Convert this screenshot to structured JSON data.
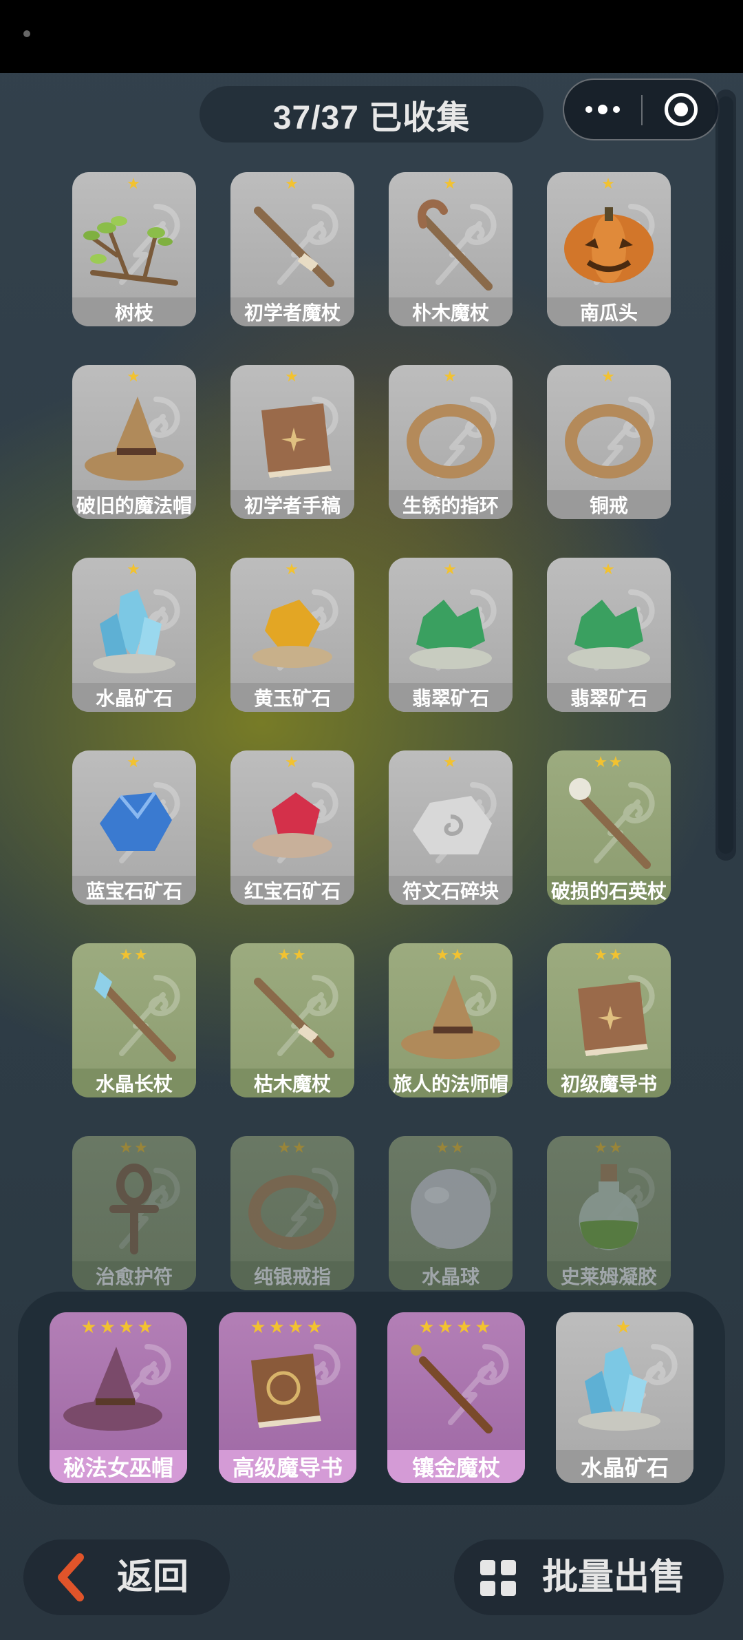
{
  "header": {
    "title": "37/37 已收集"
  },
  "collection": [
    {
      "label": "树枝",
      "stars": "★",
      "style": "g",
      "icon": "branch-icon"
    },
    {
      "label": "初学者魔杖",
      "stars": "★",
      "style": "g",
      "icon": "wand-icon"
    },
    {
      "label": "朴木魔杖",
      "stars": "★",
      "style": "g",
      "icon": "staff-icon"
    },
    {
      "label": "南瓜头",
      "stars": "★",
      "style": "g",
      "icon": "pumpkin-icon"
    },
    {
      "label": "破旧的魔法帽",
      "stars": "★",
      "style": "g",
      "icon": "hat-icon"
    },
    {
      "label": "初学者手稿",
      "stars": "★",
      "style": "g",
      "icon": "book-icon"
    },
    {
      "label": "生锈的指环",
      "stars": "★",
      "style": "g",
      "icon": "ring-icon"
    },
    {
      "label": "铜戒",
      "stars": "★",
      "style": "g",
      "icon": "ring-icon"
    },
    {
      "label": "水晶矿石",
      "stars": "★",
      "style": "g",
      "icon": "crystal-icon"
    },
    {
      "label": "黄玉矿石",
      "stars": "★",
      "style": "g",
      "icon": "topaz-icon"
    },
    {
      "label": "翡翠矿石",
      "stars": "★",
      "style": "g",
      "icon": "emerald-icon"
    },
    {
      "label": "翡翠矿石",
      "stars": "★",
      "style": "g",
      "icon": "emerald-icon"
    },
    {
      "label": "蓝宝石矿石",
      "stars": "★",
      "style": "g",
      "icon": "sapphire-icon"
    },
    {
      "label": "红宝石矿石",
      "stars": "★",
      "style": "g",
      "icon": "ruby-icon"
    },
    {
      "label": "符文石碎块",
      "stars": "★",
      "style": "g",
      "icon": "runestone-icon"
    },
    {
      "label": "破损的石英杖",
      "stars": "★★",
      "style": "gr",
      "icon": "quartz-staff-icon"
    },
    {
      "label": "水晶长杖",
      "stars": "★★",
      "style": "gr",
      "icon": "crystal-staff-icon"
    },
    {
      "label": "枯木魔杖",
      "stars": "★★",
      "style": "gr",
      "icon": "wand-icon"
    },
    {
      "label": "旅人的法师帽",
      "stars": "★★",
      "style": "gr",
      "icon": "hat-icon"
    },
    {
      "label": "初级魔导书",
      "stars": "★★",
      "style": "gr",
      "icon": "book-icon"
    },
    {
      "label": "治愈护符",
      "stars": "★★",
      "style": "gr",
      "icon": "ankh-icon"
    },
    {
      "label": "纯银戒指",
      "stars": "★★",
      "style": "gr",
      "icon": "ring-icon"
    },
    {
      "label": "水晶球",
      "stars": "★★",
      "style": "gr",
      "icon": "orb-icon"
    },
    {
      "label": "史莱姆凝胶",
      "stars": "★★",
      "style": "gr",
      "icon": "potion-icon"
    }
  ],
  "featured": [
    {
      "label": "秘法女巫帽",
      "stars": "★★★★",
      "style": "p",
      "icon": "witch-hat-icon"
    },
    {
      "label": "高级魔导书",
      "stars": "★★★★",
      "style": "p",
      "icon": "grimoire-icon"
    },
    {
      "label": "镶金魔杖",
      "stars": "★★★★",
      "style": "p",
      "icon": "gold-wand-icon"
    },
    {
      "label": "水晶矿石",
      "stars": "★",
      "style": "g",
      "icon": "crystal-icon"
    }
  ],
  "footer": {
    "back_label": "返回",
    "sell_label": "批量出售"
  },
  "colors": {
    "star": "#f2c230",
    "gray_card": "#a8a8a8",
    "green_card": "#8c9c70",
    "purple_card": "#9e68a4",
    "back_arrow": "#e0542a"
  }
}
